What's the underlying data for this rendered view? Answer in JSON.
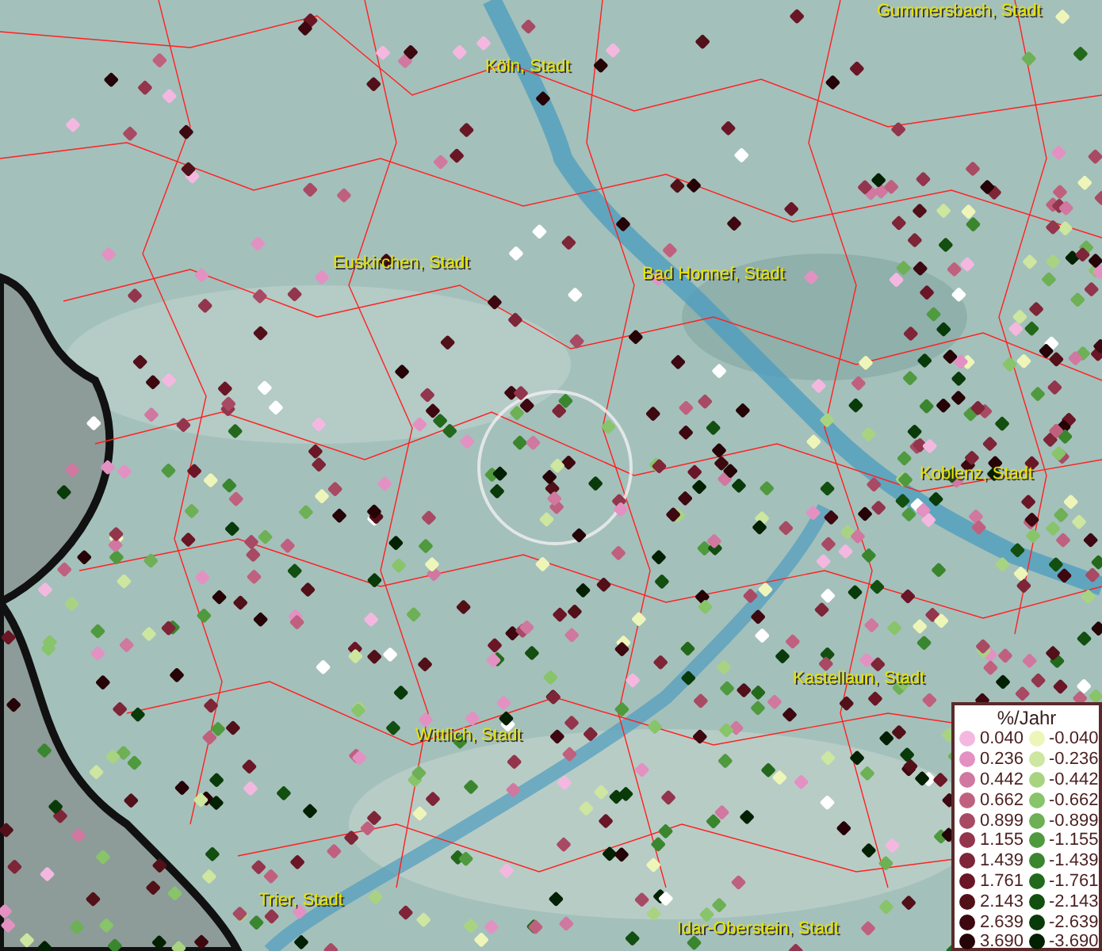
{
  "map": {
    "places": [
      {
        "name": "Gummersbach, Stadt"
      },
      {
        "name": "Köln, Stadt"
      },
      {
        "name": "Euskirchen, Stadt"
      },
      {
        "name": "Bad Honnef, Stadt"
      },
      {
        "name": "Koblenz, Stadt"
      },
      {
        "name": "Kastellaun, Stadt"
      },
      {
        "name": "Wittlich, Stadt"
      },
      {
        "name": "Trier, Stadt"
      },
      {
        "name": "Idar-Oberstein, Stadt"
      }
    ]
  },
  "legend": {
    "title": "%/Jahr",
    "positive": [
      {
        "label": "0.040",
        "color": "#f4b8e0"
      },
      {
        "label": "0.236",
        "color": "#e391c2"
      },
      {
        "label": "0.442",
        "color": "#d0789f"
      },
      {
        "label": "0.662",
        "color": "#c0607f"
      },
      {
        "label": "0.899",
        "color": "#a84a64"
      },
      {
        "label": "1.155",
        "color": "#93354d"
      },
      {
        "label": "1.439",
        "color": "#7e2538"
      },
      {
        "label": "1.761",
        "color": "#6a1626"
      },
      {
        "label": "2.143",
        "color": "#521019"
      },
      {
        "label": "2.639",
        "color": "#3d0810"
      },
      {
        "label": "3.690",
        "color": "#250306"
      }
    ],
    "negative": [
      {
        "label": "-0.040",
        "color": "#eef5b8"
      },
      {
        "label": "-0.236",
        "color": "#cde6a0"
      },
      {
        "label": "-0.442",
        "color": "#a8d482"
      },
      {
        "label": "-0.662",
        "color": "#88c46a"
      },
      {
        "label": "-0.899",
        "color": "#6db055"
      },
      {
        "label": "-1.155",
        "color": "#4f9a3e"
      },
      {
        "label": "-1.439",
        "color": "#3a862e"
      },
      {
        "label": "-1.761",
        "color": "#23691c"
      },
      {
        "label": "-2.143",
        "color": "#124f10"
      },
      {
        "label": "-2.639",
        "color": "#093a09"
      },
      {
        "label": "-3.690",
        "color": "#022002"
      }
    ]
  }
}
